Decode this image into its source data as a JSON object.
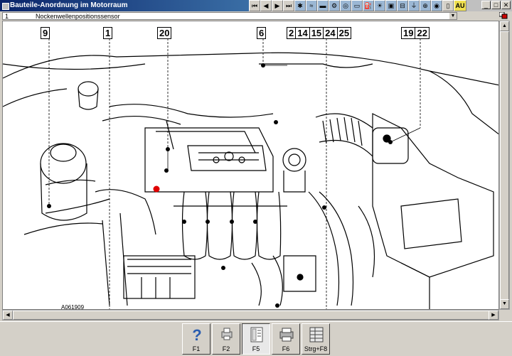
{
  "window": {
    "title": "Bauteile-Anordnung im Motorraum",
    "toolbar_icons": [
      "first-page-icon",
      "prev-page-icon",
      "next-page-icon",
      "last-page-icon",
      "component-icon",
      "wiring-icon",
      "car-icon",
      "engine-icon",
      "brake-icon",
      "battery-icon",
      "fuel-icon",
      "lamp-icon",
      "relay-icon",
      "fuse-icon",
      "ground-icon",
      "connector-icon",
      "sensor-icon",
      "book-icon",
      "au-icon"
    ],
    "au_label": "AU"
  },
  "selection": {
    "number": "1",
    "text": "Nockenwellenpositionssensor"
  },
  "drawing": {
    "code": "A061909",
    "callouts": [
      {
        "id": "c9",
        "labels": [
          "9"
        ]
      },
      {
        "id": "c1",
        "labels": [
          "1"
        ]
      },
      {
        "id": "c20",
        "labels": [
          "20"
        ]
      },
      {
        "id": "c6",
        "labels": [
          "6"
        ]
      },
      {
        "id": "c2",
        "labels": [
          "2",
          "14",
          "15",
          "24",
          "25"
        ]
      },
      {
        "id": "c19",
        "labels": [
          "19",
          "22"
        ]
      }
    ]
  },
  "fkeys": [
    {
      "name": "help",
      "label": "F1",
      "icon": "help-icon"
    },
    {
      "name": "f2",
      "label": "F2",
      "icon": "printer-small-icon"
    },
    {
      "name": "f5",
      "label": "F5",
      "icon": "document-icon"
    },
    {
      "name": "print",
      "label": "F6",
      "icon": "printer-icon"
    },
    {
      "name": "table",
      "label": "Strg+F8",
      "icon": "table-icon"
    }
  ]
}
